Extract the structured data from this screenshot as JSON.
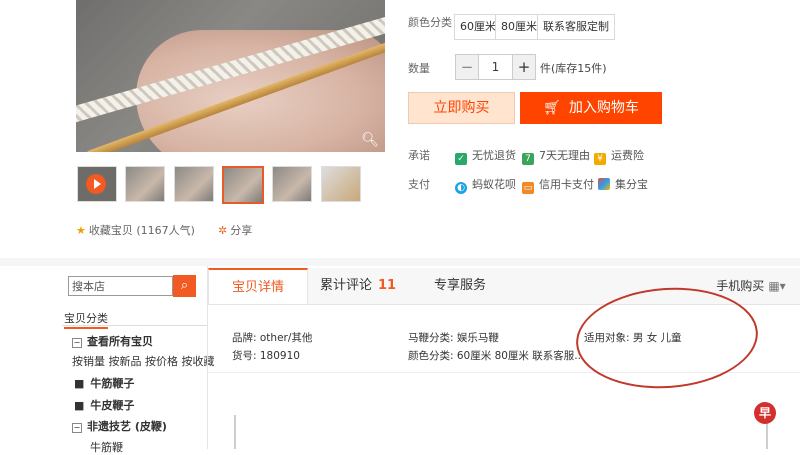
{
  "product": {
    "zoom_icon": "magnifier-icon",
    "color_label": "颜色分类",
    "color_options": [
      "60厘米",
      "80厘米",
      "联系客服定制"
    ],
    "qty_label": "数量",
    "qty_minus": "−",
    "qty_value": "1",
    "qty_plus": "+",
    "qty_stock": "件(库存15件)",
    "buy_now": "立即购买",
    "add_cart": "加入购物车",
    "promise_label": "承诺",
    "promises": [
      "无忧退货",
      "7天无理由",
      "运费险"
    ],
    "pay_label": "支付",
    "payments": [
      "蚂蚁花呗",
      "信用卡支付",
      "集分宝"
    ],
    "favorite": "收藏宝贝 (1167人气)",
    "share": "分享"
  },
  "sidebar": {
    "search_placeholder": "搜本店",
    "category_title": "宝贝分类",
    "all_items": "查看所有宝贝",
    "sort_links": [
      "按销量",
      "按新品",
      "按价格",
      "按收藏"
    ],
    "categories": [
      "牛筋鞭子",
      "牛皮鞭子",
      "非遗技艺 (皮鞭)"
    ],
    "sub_item": "牛筋鞭"
  },
  "tabs": {
    "details": "宝贝详情",
    "reviews": "累计评论",
    "reviews_count": "11",
    "service": "专享服务",
    "mobile": "手机购买"
  },
  "attributes": {
    "brand": "品牌: other/其他",
    "item_no": "货号: 180910",
    "type": "马鞭分类: 娱乐马鞭",
    "color": "颜色分类: 60厘米 80厘米 联系客服...",
    "target": "适用对象: 男 女 儿童"
  },
  "watermark": "早"
}
